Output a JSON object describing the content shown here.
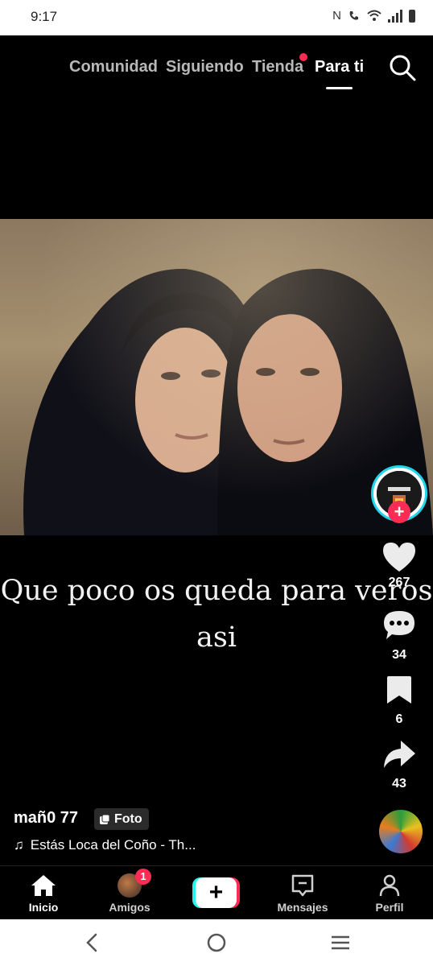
{
  "status_bar": {
    "time": "9:17",
    "icons": [
      "nfc-icon",
      "wifi-call-icon",
      "wifi-icon",
      "signal-icon",
      "battery-icon"
    ]
  },
  "top_nav": {
    "tabs": [
      {
        "label": "Comunidad"
      },
      {
        "label": "Siguiendo"
      },
      {
        "label": "Tienda",
        "dot": true
      },
      {
        "label": "Para ti",
        "active": true
      }
    ],
    "search_icon": "search-icon"
  },
  "post": {
    "caption_line1": "Que poco os queda para veros",
    "caption_line2": "asi",
    "author": "mañ0 77",
    "badge": "Foto",
    "music": "Estás Loca del Coño - Th..."
  },
  "actions": {
    "likes": "267",
    "comments": "34",
    "saves": "6",
    "shares": "43"
  },
  "bottom_nav": {
    "items": [
      {
        "label": "Inicio",
        "icon": "home-icon",
        "active": true
      },
      {
        "label": "Amigos",
        "icon": "friends-avatar",
        "badge": "1"
      },
      {
        "label": "",
        "icon": "create-icon"
      },
      {
        "label": "Mensajes",
        "icon": "inbox-icon"
      },
      {
        "label": "Perfil",
        "icon": "profile-icon"
      }
    ]
  },
  "colors": {
    "accent": "#fe2c55",
    "cyan": "#25f4ee",
    "background": "#000000"
  }
}
